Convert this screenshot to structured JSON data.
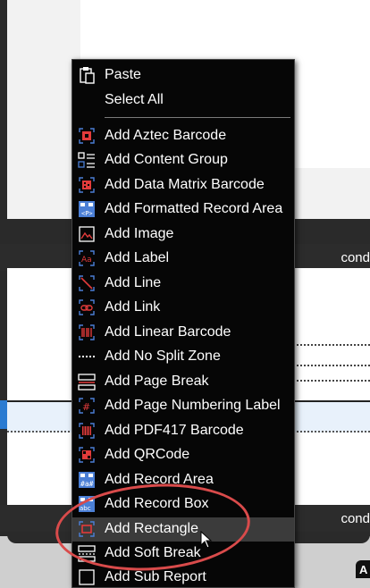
{
  "background": {
    "band_texts": [
      "cond",
      "cond"
    ],
    "corner_text": "A"
  },
  "menu": {
    "items": [
      {
        "label": "Paste",
        "icon": "clipboard-icon"
      },
      {
        "label": "Select All",
        "icon": ""
      },
      {
        "label": "Add Aztec Barcode",
        "icon": "aztec-barcode-icon"
      },
      {
        "label": "Add Content Group",
        "icon": "content-group-icon"
      },
      {
        "label": "Add Data Matrix Barcode",
        "icon": "data-matrix-icon"
      },
      {
        "label": "Add Formatted Record Area",
        "icon": "formatted-record-icon"
      },
      {
        "label": "Add Image",
        "icon": "image-icon"
      },
      {
        "label": "Add Label",
        "icon": "label-icon"
      },
      {
        "label": "Add Line",
        "icon": "line-icon"
      },
      {
        "label": "Add Link",
        "icon": "link-icon"
      },
      {
        "label": "Add Linear Barcode",
        "icon": "linear-barcode-icon"
      },
      {
        "label": "Add No Split Zone",
        "icon": "no-split-zone-icon"
      },
      {
        "label": "Add Page Break",
        "icon": "page-break-icon"
      },
      {
        "label": "Add Page Numbering Label",
        "icon": "page-number-icon"
      },
      {
        "label": "Add PDF417 Barcode",
        "icon": "pdf417-icon"
      },
      {
        "label": "Add QRCode",
        "icon": "qrcode-icon"
      },
      {
        "label": "Add Record Area",
        "icon": "record-area-icon"
      },
      {
        "label": "Add Record Box",
        "icon": "record-box-icon"
      },
      {
        "label": "Add Rectangle",
        "icon": "rectangle-icon"
      },
      {
        "label": "Add Soft Break",
        "icon": "soft-break-icon"
      },
      {
        "label": "Add Sub Report",
        "icon": "sub-report-icon"
      }
    ],
    "hovered_item": "Add Rectangle"
  },
  "colors": {
    "menu_bg": "#060606",
    "hover_bg": "#3b3b3b",
    "icon_accent": "#e23b3b",
    "icon_blue": "#4b7fd6",
    "annotation_circle": "#d94b4b"
  }
}
